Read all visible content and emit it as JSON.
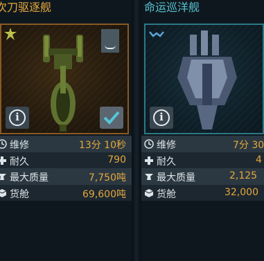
{
  "cards": [
    {
      "title": "次刀驱逐舰",
      "icons": {
        "badge": "star-burst-icon",
        "tag": "bookmark-icon",
        "info": "info-icon",
        "select": "checkmark-icon"
      },
      "info_label": "i",
      "stats": [
        {
          "icon": "clock-icon",
          "label": "维修",
          "value": "13分 10秒"
        },
        {
          "icon": "plus-icon",
          "label": "耐久",
          "value": "790"
        },
        {
          "icon": "anvil-icon",
          "label": "最大质量",
          "value": "7,750吨"
        },
        {
          "icon": "cargo-icon",
          "label": "货舱",
          "value": "69,600吨"
        }
      ]
    },
    {
      "title": "命运巡洋舰",
      "icons": {
        "badge": "wings-icon",
        "info": "info-icon"
      },
      "info_label": "i",
      "stats": [
        {
          "icon": "clock-icon",
          "label": "维修",
          "value": "7分 30"
        },
        {
          "icon": "plus-icon",
          "label": "耐久",
          "value": "4"
        },
        {
          "icon": "anvil-icon",
          "label": "最大质量",
          "value": "2,125"
        },
        {
          "icon": "cargo-icon",
          "label": "货舱",
          "value": "32,000"
        }
      ]
    }
  ],
  "colors": {
    "title_left": "#e6a83c",
    "title_right": "#58c1cf",
    "value": "#e6a83c",
    "frame_left": "#8a5a23",
    "frame_right": "#2a7a86"
  }
}
